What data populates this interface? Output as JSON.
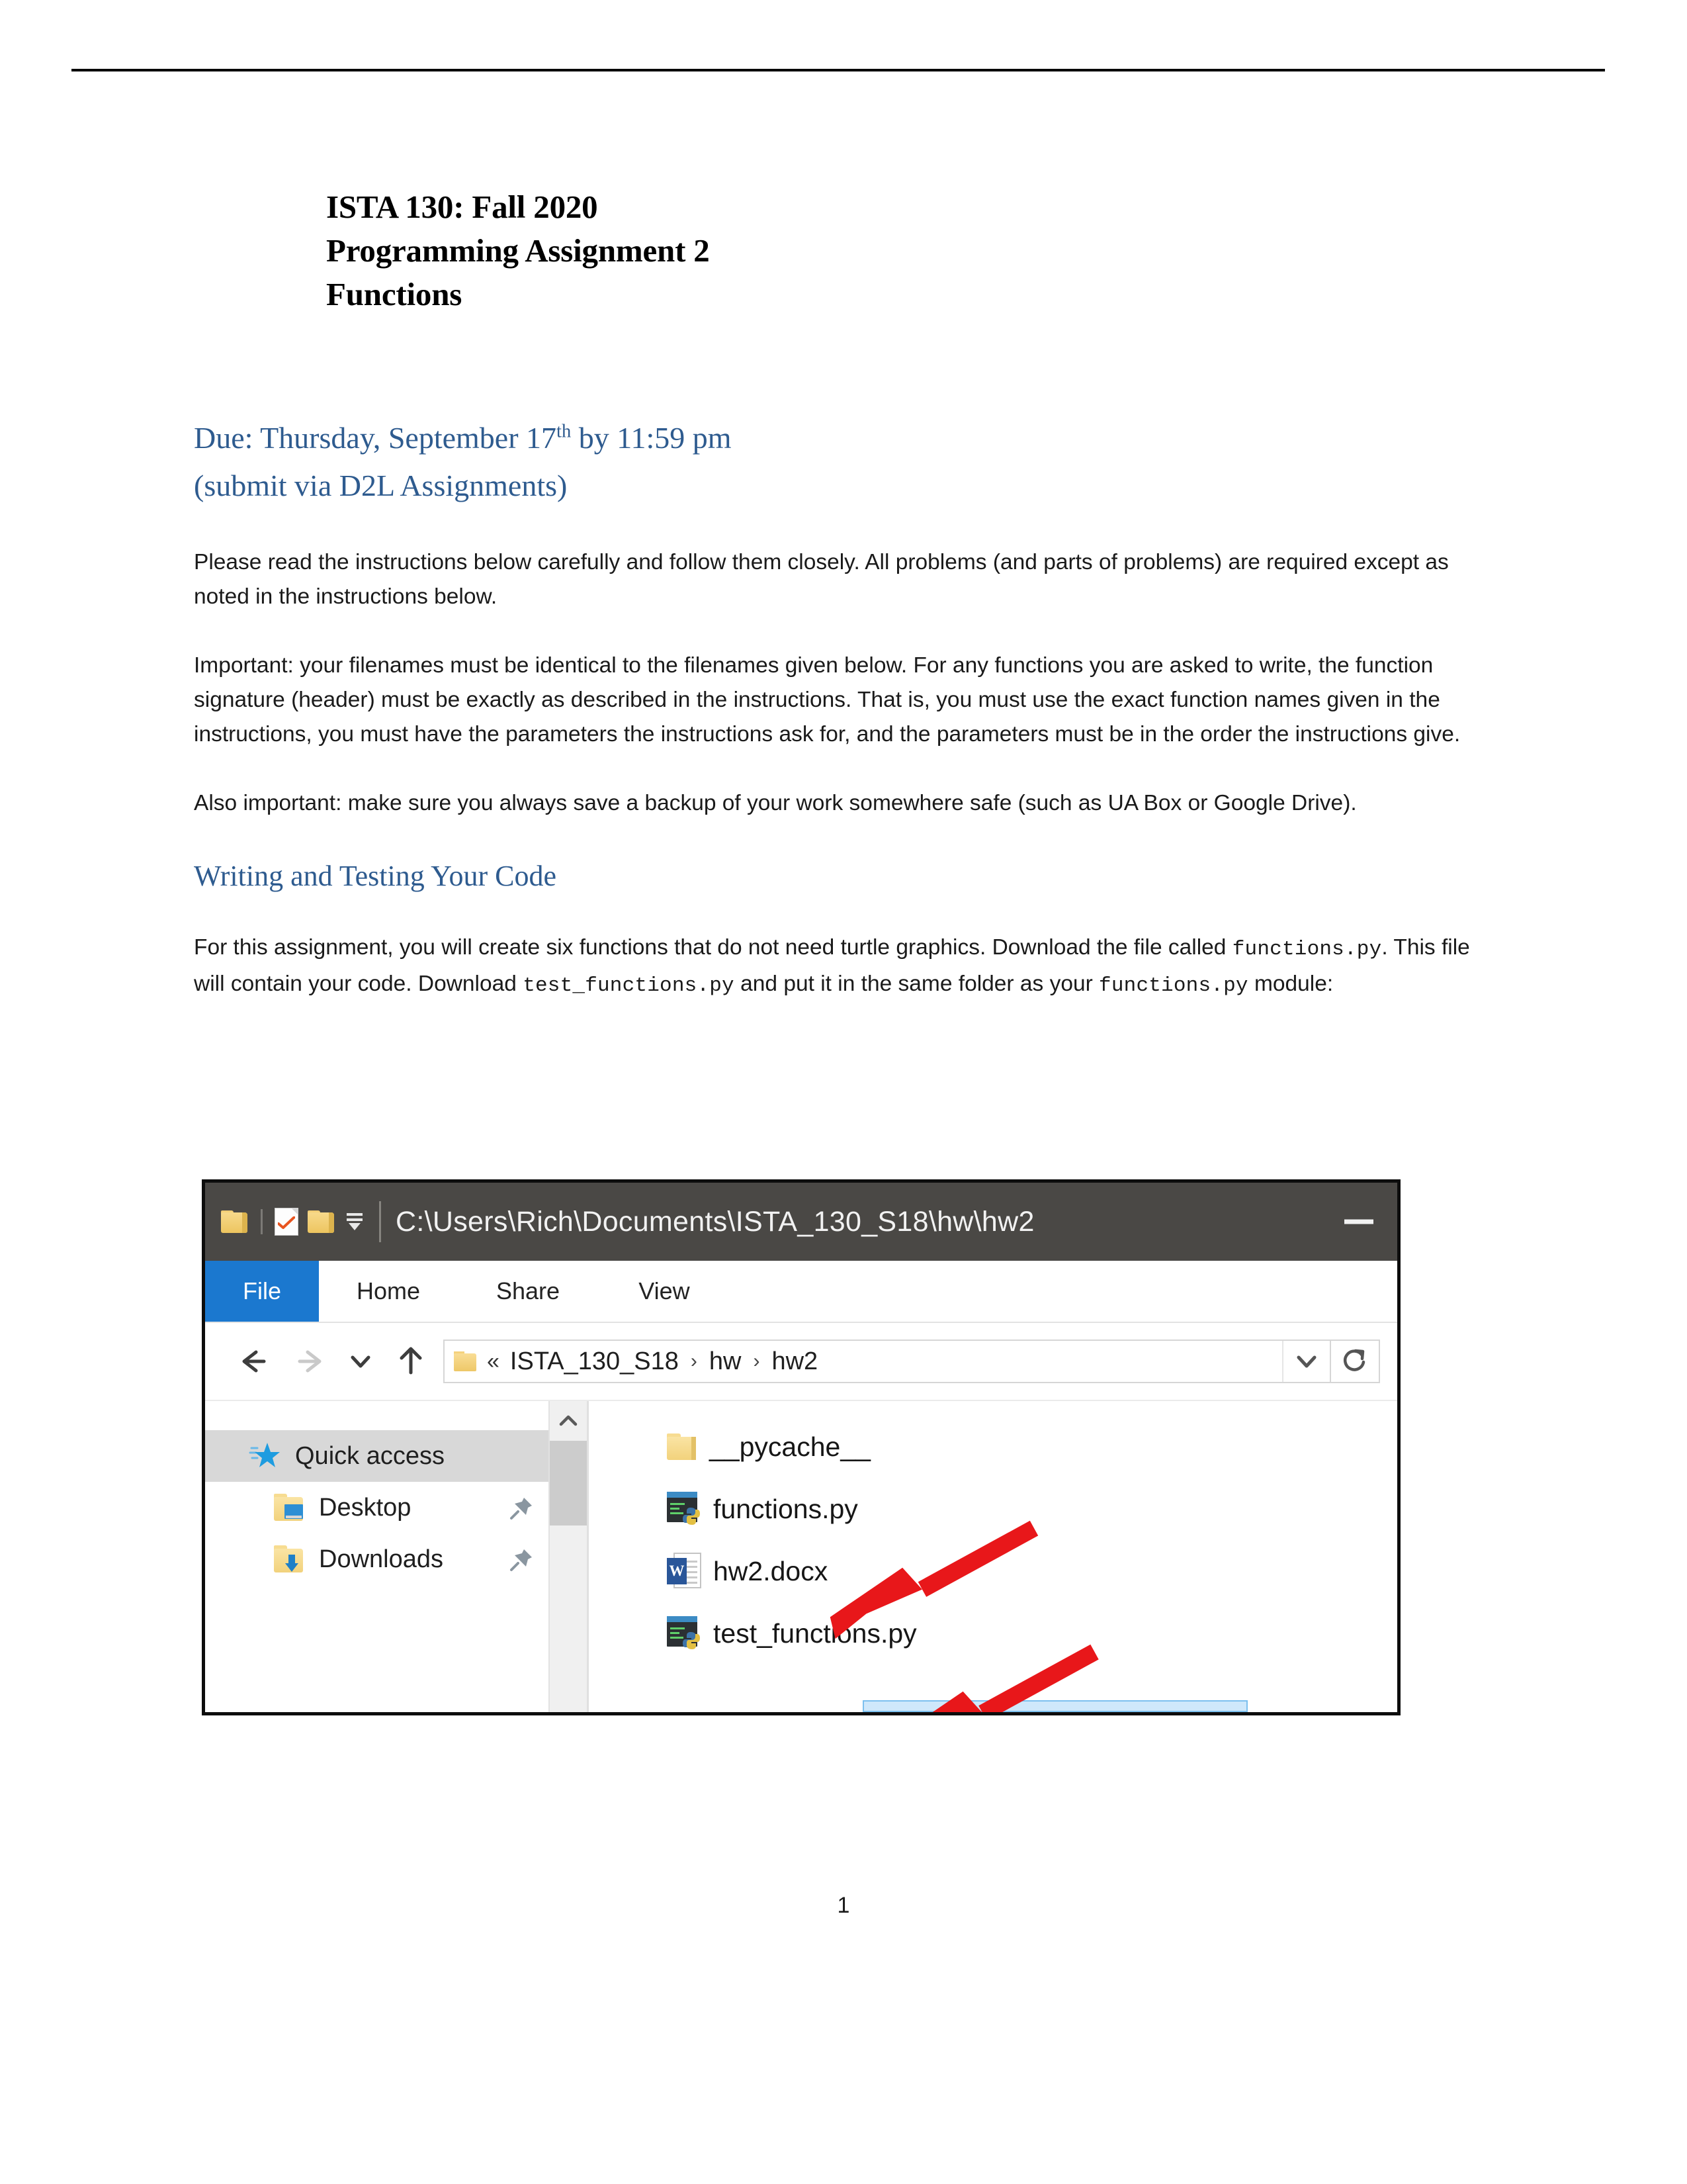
{
  "document": {
    "title_lines": [
      "ISTA 130: Fall 2020",
      "Programming Assignment 2",
      "Functions"
    ],
    "due_line_1_pre": "Due: Thursday, September 17",
    "due_line_1_sup": "th",
    "due_line_1_post": " by 11:59 pm",
    "due_line_2": "(submit via D2L Assignments)",
    "paragraph_1": "Please read the instructions below carefully and follow them closely.  All problems (and parts of problems) are required except as noted in the instructions below.",
    "paragraph_2": "Important: your filenames must be identical to the filenames given below.  For any functions you are asked to write, the function signature (header) must be exactly as described in the instructions.  That is, you must use the exact function names given in the instructions, you must have the parameters the instructions ask for, and the parameters must be in the order the instructions give.",
    "paragraph_3": "Also important: make sure you always save a backup of your work somewhere safe (such as UA Box or Google Drive).",
    "section_heading": "Writing and Testing Your Code",
    "paragraph_4_a": "For this assignment, you will create six functions that do not need turtle graphics.  Download the file called ",
    "paragraph_4_code_1": "functions.py",
    "paragraph_4_b": ".  This file will contain your code.  Download ",
    "paragraph_4_code_2": "test_functions.py",
    "paragraph_4_c": " and put it in the same folder as your ",
    "paragraph_4_code_3": "functions.py",
    "paragraph_4_d": " module:",
    "page_number": "1",
    "heading_color": "#2e5b8f"
  },
  "explorer": {
    "title_path": "C:\\Users\\Rich\\Documents\\ISTA_130_S18\\hw\\hw2",
    "quick_access_toolbar": {
      "folder_label": "folder",
      "properties_label": "properties",
      "new_folder_label": "new folder",
      "customize_label": "customize quick access toolbar"
    },
    "minimize_label": "Minimize",
    "tabs": [
      {
        "label": "File",
        "active": true
      },
      {
        "label": "Home",
        "active": false
      },
      {
        "label": "Share",
        "active": false
      },
      {
        "label": "View",
        "active": false
      }
    ],
    "nav": {
      "back": "Back",
      "forward": "Forward",
      "recent": "Recent locations",
      "up": "Up one level",
      "refresh": "Refresh",
      "dropdown": "Previous locations"
    },
    "breadcrumb": {
      "overflow": "«",
      "items": [
        "ISTA_130_S18",
        "hw",
        "hw2"
      ],
      "separator": "›"
    },
    "sidebar": [
      {
        "label": "Quick access",
        "icon": "star-icon",
        "selected": true,
        "pinned": false
      },
      {
        "label": "Desktop",
        "icon": "desktop-folder-icon",
        "selected": false,
        "pinned": true
      },
      {
        "label": "Downloads",
        "icon": "downloads-folder-icon",
        "selected": false,
        "pinned": true
      }
    ],
    "files": [
      {
        "name": "__pycache__",
        "icon": "folder-icon"
      },
      {
        "name": "functions.py",
        "icon": "python-file-icon"
      },
      {
        "name": "hw2.docx",
        "icon": "word-file-icon"
      },
      {
        "name": "test_functions.py",
        "icon": "python-file-icon"
      }
    ],
    "word_icon_letter": "W",
    "accent_tab_color": "#1b78cf",
    "titlebar_color": "#4a4845",
    "annotation_arrow_color": "#e8171a",
    "annotation_arrows": 2
  }
}
